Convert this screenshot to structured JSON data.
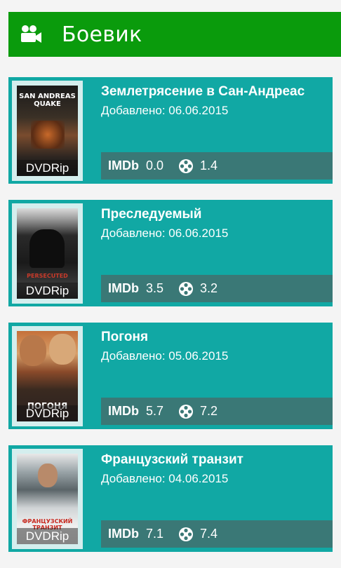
{
  "header": {
    "title": "Боевик",
    "icon": "video-camera-icon",
    "color": "#0a9b0c"
  },
  "movies": [
    {
      "title": "Землетрясение в Сан-Андреас",
      "added": "Добавлено: 06.06.2015",
      "quality": "DVDRip",
      "imdb_label": "IMDb",
      "imdb": "0.0",
      "kp": "1.4",
      "poster_text": "SAN ANDREAS QUAKE"
    },
    {
      "title": "Преследуемый",
      "added": "Добавлено: 06.06.2015",
      "quality": "DVDRip",
      "imdb_label": "IMDb",
      "imdb": "3.5",
      "kp": "3.2",
      "poster_text": "PERSECUTED"
    },
    {
      "title": "Погоня",
      "added": "Добавлено: 05.06.2015",
      "quality": "DVDRip",
      "imdb_label": "IMDb",
      "imdb": "5.7",
      "kp": "7.2",
      "poster_text": "ПОГОНЯ"
    },
    {
      "title": "Французский транзит",
      "added": "Добавлено: 04.06.2015",
      "quality": "DVDRip",
      "imdb_label": "IMDb",
      "imdb": "7.1",
      "kp": "7.4",
      "poster_text": "ФРАНЦУЗСКИЙ ТРАНЗИТ"
    }
  ],
  "colors": {
    "card": "#11a8a4",
    "ratings_bar": "#3a7876",
    "background": "#f4f4f4"
  }
}
